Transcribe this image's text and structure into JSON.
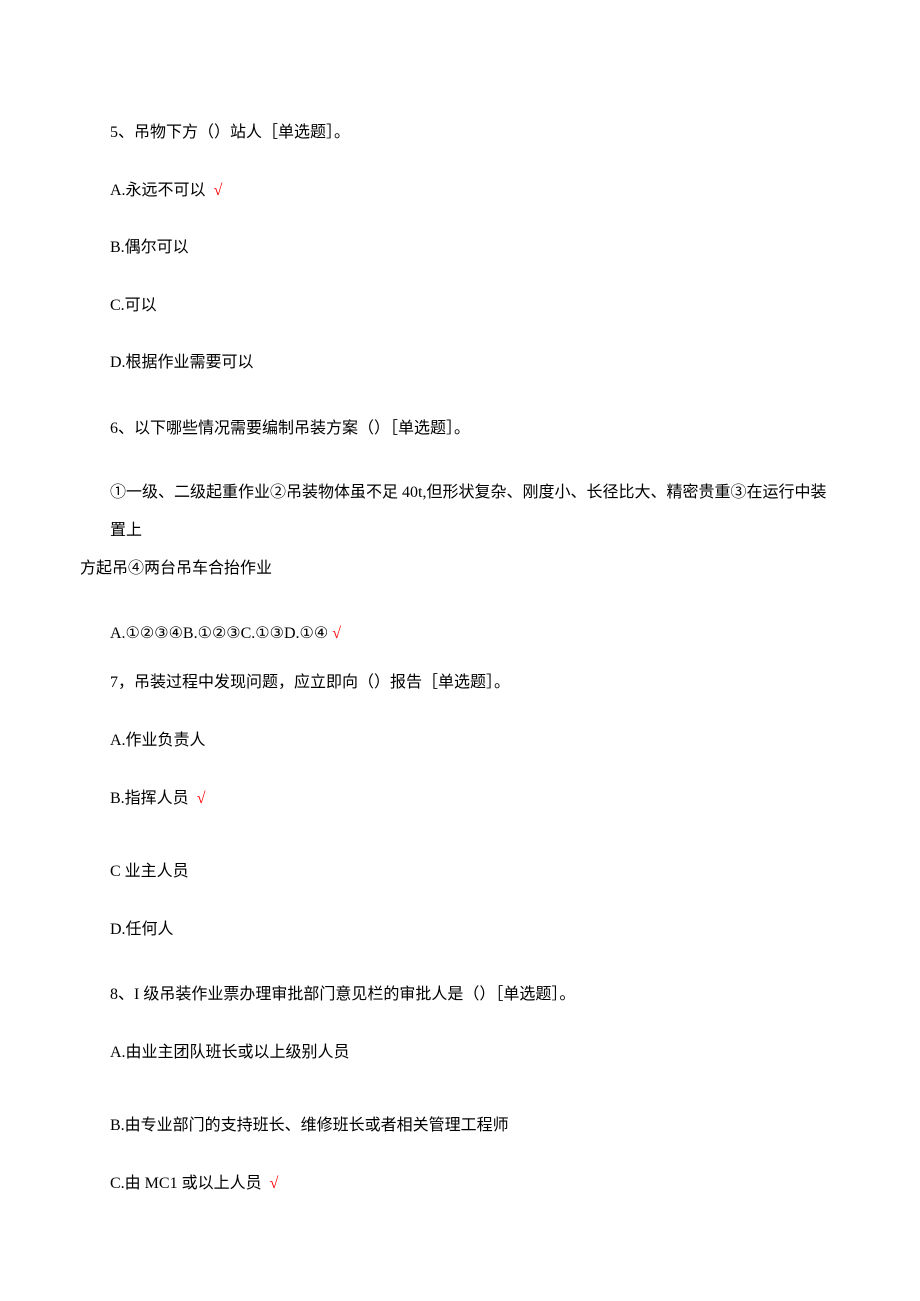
{
  "q5": {
    "text": "5、吊物下方（）站人［单选题］。",
    "options": {
      "a": "A.永远不可以",
      "b": "B.偶尔可以",
      "c": "C.可以",
      "d": "D.根据作业需要可以"
    },
    "check": "√"
  },
  "q6": {
    "text": "6、以下哪些情况需要编制吊装方案（）［单选题］。",
    "sub_line1": "①一级、二级起重作业②吊装物体虽不足 40t,但形状复杂、刚度小、长径比大、精密贵重③在运行中装置上",
    "sub_line2": "方起吊④两台吊车合抬作业",
    "options_combined": "A.①②③④B.①②③C.①③D.①④",
    "check": "√"
  },
  "q7": {
    "text": "7，吊装过程中发现问题，应立即向（）报告［单选题］。",
    "options": {
      "a": "A.作业负责人",
      "b": "B.指挥人员",
      "c": "C 业主人员",
      "d": "D.任何人"
    },
    "check": "√"
  },
  "q8": {
    "text": "8、I 级吊装作业票办理审批部门意见栏的审批人是（）［单选题］。",
    "options": {
      "a": "A.由业主团队班长或以上级别人员",
      "b": "B.由专业部门的支持班长、维修班长或者相关管理工程师",
      "c": "C.由 MC1 或以上人员"
    },
    "check": "√"
  }
}
